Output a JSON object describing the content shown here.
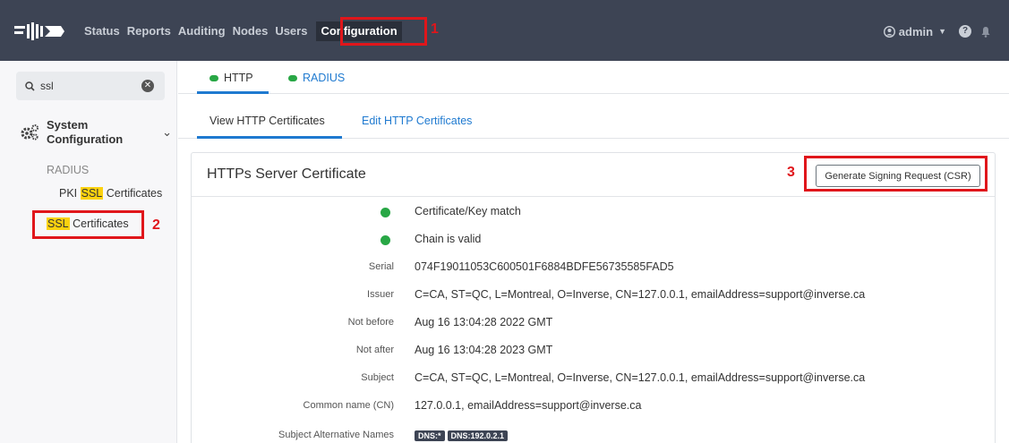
{
  "navbar": {
    "links": [
      "Status",
      "Reports",
      "Auditing",
      "Nodes",
      "Users"
    ],
    "active_link": "Configuration",
    "user": "admin",
    "help_icon": "?",
    "bell_icon": "bell-icon"
  },
  "markers": {
    "one": "1",
    "two": "2",
    "three": "3"
  },
  "sidebar": {
    "search_value": "ssl",
    "section_label": "System Configuration",
    "radius_label": "RADIUS",
    "pki_prefix": "PKI ",
    "pki_highlight": "SSL",
    "pki_suffix": " Certificates",
    "ssl_highlight": "SSL",
    "ssl_suffix": " Certificates"
  },
  "tabs": {
    "primary": [
      "HTTP",
      "RADIUS"
    ],
    "secondary": [
      "View HTTP Certificates",
      "Edit HTTP Certificates"
    ]
  },
  "card": {
    "title": "HTTPs Server Certificate",
    "csr_button": "Generate Signing Request (CSR)",
    "status_rows": [
      "Certificate/Key match",
      "Chain is valid"
    ],
    "fields": [
      {
        "key": "Serial",
        "value": "074F19011053C600501F6884BDFE56735585FAD5"
      },
      {
        "key": "Issuer",
        "value": "C=CA, ST=QC, L=Montreal, O=Inverse, CN=127.0.0.1, emailAddress=support@inverse.ca"
      },
      {
        "key": "Not before",
        "value": "Aug 16 13:04:28 2022 GMT"
      },
      {
        "key": "Not after",
        "value": "Aug 16 13:04:28 2023 GMT"
      },
      {
        "key": "Subject",
        "value": "C=CA, ST=QC, L=Montreal, O=Inverse, CN=127.0.0.1, emailAddress=support@inverse.ca"
      },
      {
        "key": "Common name (CN)",
        "value": "127.0.0.1, emailAddress=support@inverse.ca"
      }
    ],
    "san": {
      "key": "Subject Alternative Names",
      "badges": [
        "DNS:*",
        "DNS:192.0.2.1"
      ]
    }
  },
  "colors": {
    "navbar": "#3d4454",
    "accent": "#1f7ad0",
    "ok": "#28a745",
    "highlight": "#fcd20f",
    "annotation": "#e0161b"
  }
}
